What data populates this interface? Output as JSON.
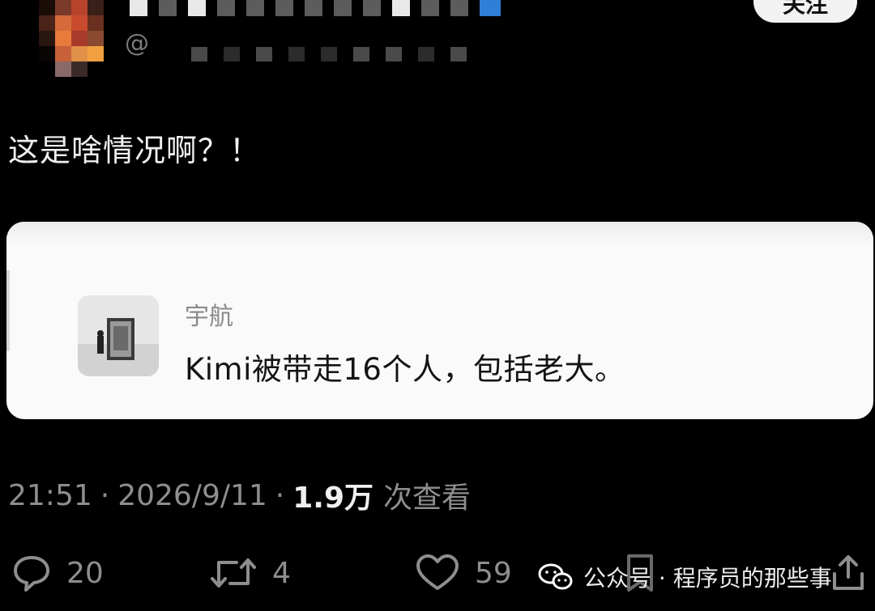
{
  "post": {
    "follow_label": "关注",
    "handle_prefix": "@",
    "text": "这是啥情况啊？！"
  },
  "quote": {
    "author": "宇航",
    "text": "Kimi被带走16个人，包括老大。"
  },
  "meta": {
    "time": "21:51",
    "date": "2026/9/11",
    "separator": "·",
    "views_count": "1.9万",
    "views_label": "次查看"
  },
  "actions": {
    "replies": "20",
    "reposts": "4",
    "likes": "59"
  },
  "watermark": {
    "text": "公众号 · 程序员的那些事"
  },
  "colors": {
    "background": "#000000",
    "card": "#fafafa",
    "muted_text": "#8e8e8e"
  }
}
